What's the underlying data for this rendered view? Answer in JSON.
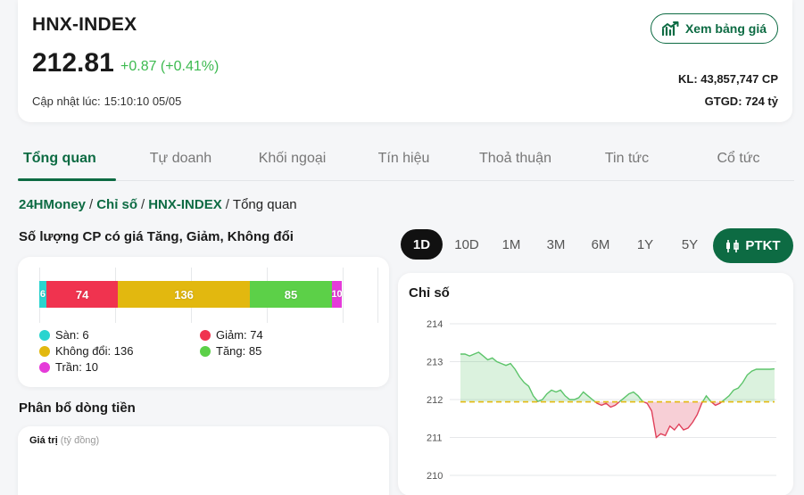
{
  "header": {
    "index_name": "HNX-INDEX",
    "price": "212.81",
    "change": "+0.87 (+0.41%)",
    "updated_label": "Cập nhật lúc:",
    "updated_value": "15:10:10 05/05",
    "board_button": "Xem bảng giá",
    "volume": "KL: 43,857,747 CP",
    "value": "GTGD: 724 tỷ",
    "accent_color": "#0d6b43",
    "up_color": "#3dba50"
  },
  "tabs": [
    {
      "label": "Tổng quan",
      "active": true
    },
    {
      "label": "Tự doanh",
      "active": false
    },
    {
      "label": "Khối ngoại",
      "active": false
    },
    {
      "label": "Tín hiệu",
      "active": false
    },
    {
      "label": "Thoả thuận",
      "active": false
    },
    {
      "label": "Tin tức",
      "active": false
    },
    {
      "label": "Cổ tức",
      "active": false
    }
  ],
  "breadcrumb": {
    "home": "24HMoney",
    "section": "Chỉ số",
    "index": "HNX-INDEX",
    "current": "Tổng quan",
    "separator": "/"
  },
  "breadth": {
    "title": "Số lượng CP có giá Tăng, Giảm, Không đổi",
    "segments": [
      {
        "key": "san",
        "label": "Sàn",
        "count": 6,
        "color": "#2ad4cf"
      },
      {
        "key": "giam",
        "label": "Giảm",
        "count": 74,
        "color": "#f0334f"
      },
      {
        "key": "khongdoi",
        "label": "Không đổi",
        "count": 136,
        "color": "#e2b80f"
      },
      {
        "key": "tang",
        "label": "Tăng",
        "count": 85,
        "color": "#5cd048"
      },
      {
        "key": "tran",
        "label": "Trần",
        "count": 10,
        "color": "#e53bd9"
      }
    ],
    "legend": {
      "san": "Sàn: 6",
      "giam": "Giảm: 74",
      "khongdoi": "Không đổi: 136",
      "tang": "Tăng: 85",
      "tran": "Trần: 10"
    }
  },
  "money_flow": {
    "title": "Phân bổ dòng tiền",
    "value_label": "Giá trị",
    "unit": "(tỷ đồng)"
  },
  "periods": {
    "items": [
      "1D",
      "10D",
      "1M",
      "3M",
      "6M",
      "1Y",
      "5Y"
    ],
    "active": "1D",
    "ptkt_button": "PTKT"
  },
  "chart_data": {
    "type": "area",
    "title": "Chỉ số",
    "reference": 211.94,
    "ylim": [
      210,
      214
    ],
    "yticks": [
      "214",
      "213",
      "212",
      "211",
      "210"
    ],
    "values": [
      213.2,
      213.2,
      213.15,
      213.2,
      213.25,
      213.15,
      213.05,
      213.1,
      213.0,
      212.95,
      212.9,
      212.95,
      212.8,
      212.6,
      212.45,
      212.35,
      212.1,
      211.95,
      212.0,
      212.15,
      212.25,
      212.2,
      212.25,
      212.1,
      212.0,
      212.0,
      212.05,
      212.2,
      212.1,
      212.0,
      211.9,
      211.85,
      211.9,
      211.8,
      211.85,
      211.95,
      212.05,
      212.15,
      212.2,
      212.1,
      211.95,
      211.9,
      211.7,
      211.0,
      211.1,
      211.05,
      211.3,
      211.2,
      211.35,
      211.2,
      211.25,
      211.4,
      211.6,
      211.9,
      212.1,
      211.95,
      211.85,
      211.9,
      212.0,
      212.1,
      212.25,
      212.3,
      212.45,
      212.65,
      212.75,
      212.8,
      212.8,
      212.8,
      212.8,
      212.81
    ],
    "up_color": "#5cc46a",
    "down_color": "#e0405a",
    "reference_color": "#e2b80f",
    "grid": true
  }
}
